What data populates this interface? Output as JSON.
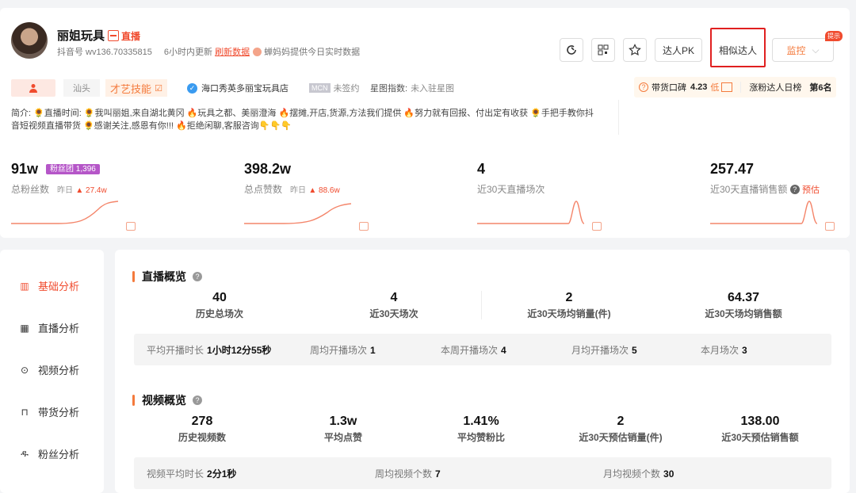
{
  "profile": {
    "name": "丽姐玩具",
    "live_label": "直播",
    "account_id": "抖音号 wv136.70335815",
    "update_text": "6小时内更新",
    "refresh_label": "刷新数据",
    "provider_text": "蝉妈妈提供今日实时数据"
  },
  "header_buttons": {
    "pk": "达人PK",
    "similar": "相似达人",
    "monitor": "监控",
    "corner_badge": "提示"
  },
  "tags": {
    "city": "汕头",
    "talent": "才艺技能",
    "shop": "海口秀英多丽宝玩具店",
    "mcn_badge": "MCN",
    "mcn_status": "未签约",
    "star_label": "星图指数:",
    "star_value": "未入驻星图"
  },
  "right_tags": {
    "reputation_label": "带货口碑",
    "reputation_value": "4.23",
    "reputation_level": "低",
    "rank_label": "涨粉达人日榜",
    "rank_value": "第6名"
  },
  "intro": {
    "line1": "简介: 🌻直播时间: 🌻我叫丽姐,来自湖北黄冈 🔥玩具之都、美丽澄海 🔥摆摊,开店,货源,方法我们提供 🔥努力就有回报、付出定有收获 🌻手把手教你抖",
    "line2": "音短视频直播带货 🌻感谢关注,感恩有你!!! 🔥拒绝闲聊,客服咨询👇👇👇"
  },
  "stats": [
    {
      "value": "91w",
      "label": "总粉丝数",
      "yesterday": "昨日",
      "delta": "▲ 27.4w",
      "badge": "粉丝团 1,396"
    },
    {
      "value": "398.2w",
      "label": "总点赞数",
      "yesterday": "昨日",
      "delta": "▲ 88.6w"
    },
    {
      "value": "4",
      "label": "近30天直播场次"
    },
    {
      "value": "257.47",
      "label": "近30天直播销售额",
      "extra": "预估"
    }
  ],
  "sidebar": {
    "items": [
      {
        "label": "基础分析"
      },
      {
        "label": "直播分析"
      },
      {
        "label": "视频分析"
      },
      {
        "label": "带货分析"
      },
      {
        "label": "粉丝分析"
      }
    ]
  },
  "live_overview": {
    "title": "直播概览",
    "kpis": [
      {
        "value": "40",
        "label": "历史总场次"
      },
      {
        "value": "4",
        "label": "近30天场次"
      },
      {
        "value": "2",
        "label": "近30天场均销量(件)"
      },
      {
        "value": "64.37",
        "label": "近30天场均销售额"
      }
    ],
    "details": [
      {
        "label": "平均开播时长",
        "value": "1小时12分55秒"
      },
      {
        "label": "周均开播场次",
        "value": "1"
      },
      {
        "label": "本周开播场次",
        "value": "4"
      },
      {
        "label": "月均开播场次",
        "value": "5"
      },
      {
        "label": "本月场次",
        "value": "3"
      }
    ]
  },
  "video_overview": {
    "title": "视频概览",
    "kpis": [
      {
        "value": "278",
        "label": "历史视频数"
      },
      {
        "value": "1.3w",
        "label": "平均点赞"
      },
      {
        "value": "1.41%",
        "label": "平均赞粉比"
      },
      {
        "value": "2",
        "label": "近30天预估销量(件)"
      },
      {
        "value": "138.00",
        "label": "近30天预估销售额"
      }
    ],
    "details": [
      {
        "label": "视频平均时长",
        "value": "2分1秒"
      },
      {
        "label": "周均视频个数",
        "value": "7"
      },
      {
        "label": "月均视频个数",
        "value": "30"
      }
    ]
  },
  "colors": {
    "accent": "#f04b2e",
    "orange": "#f47a3c",
    "fans_badge": "#b556c8"
  }
}
